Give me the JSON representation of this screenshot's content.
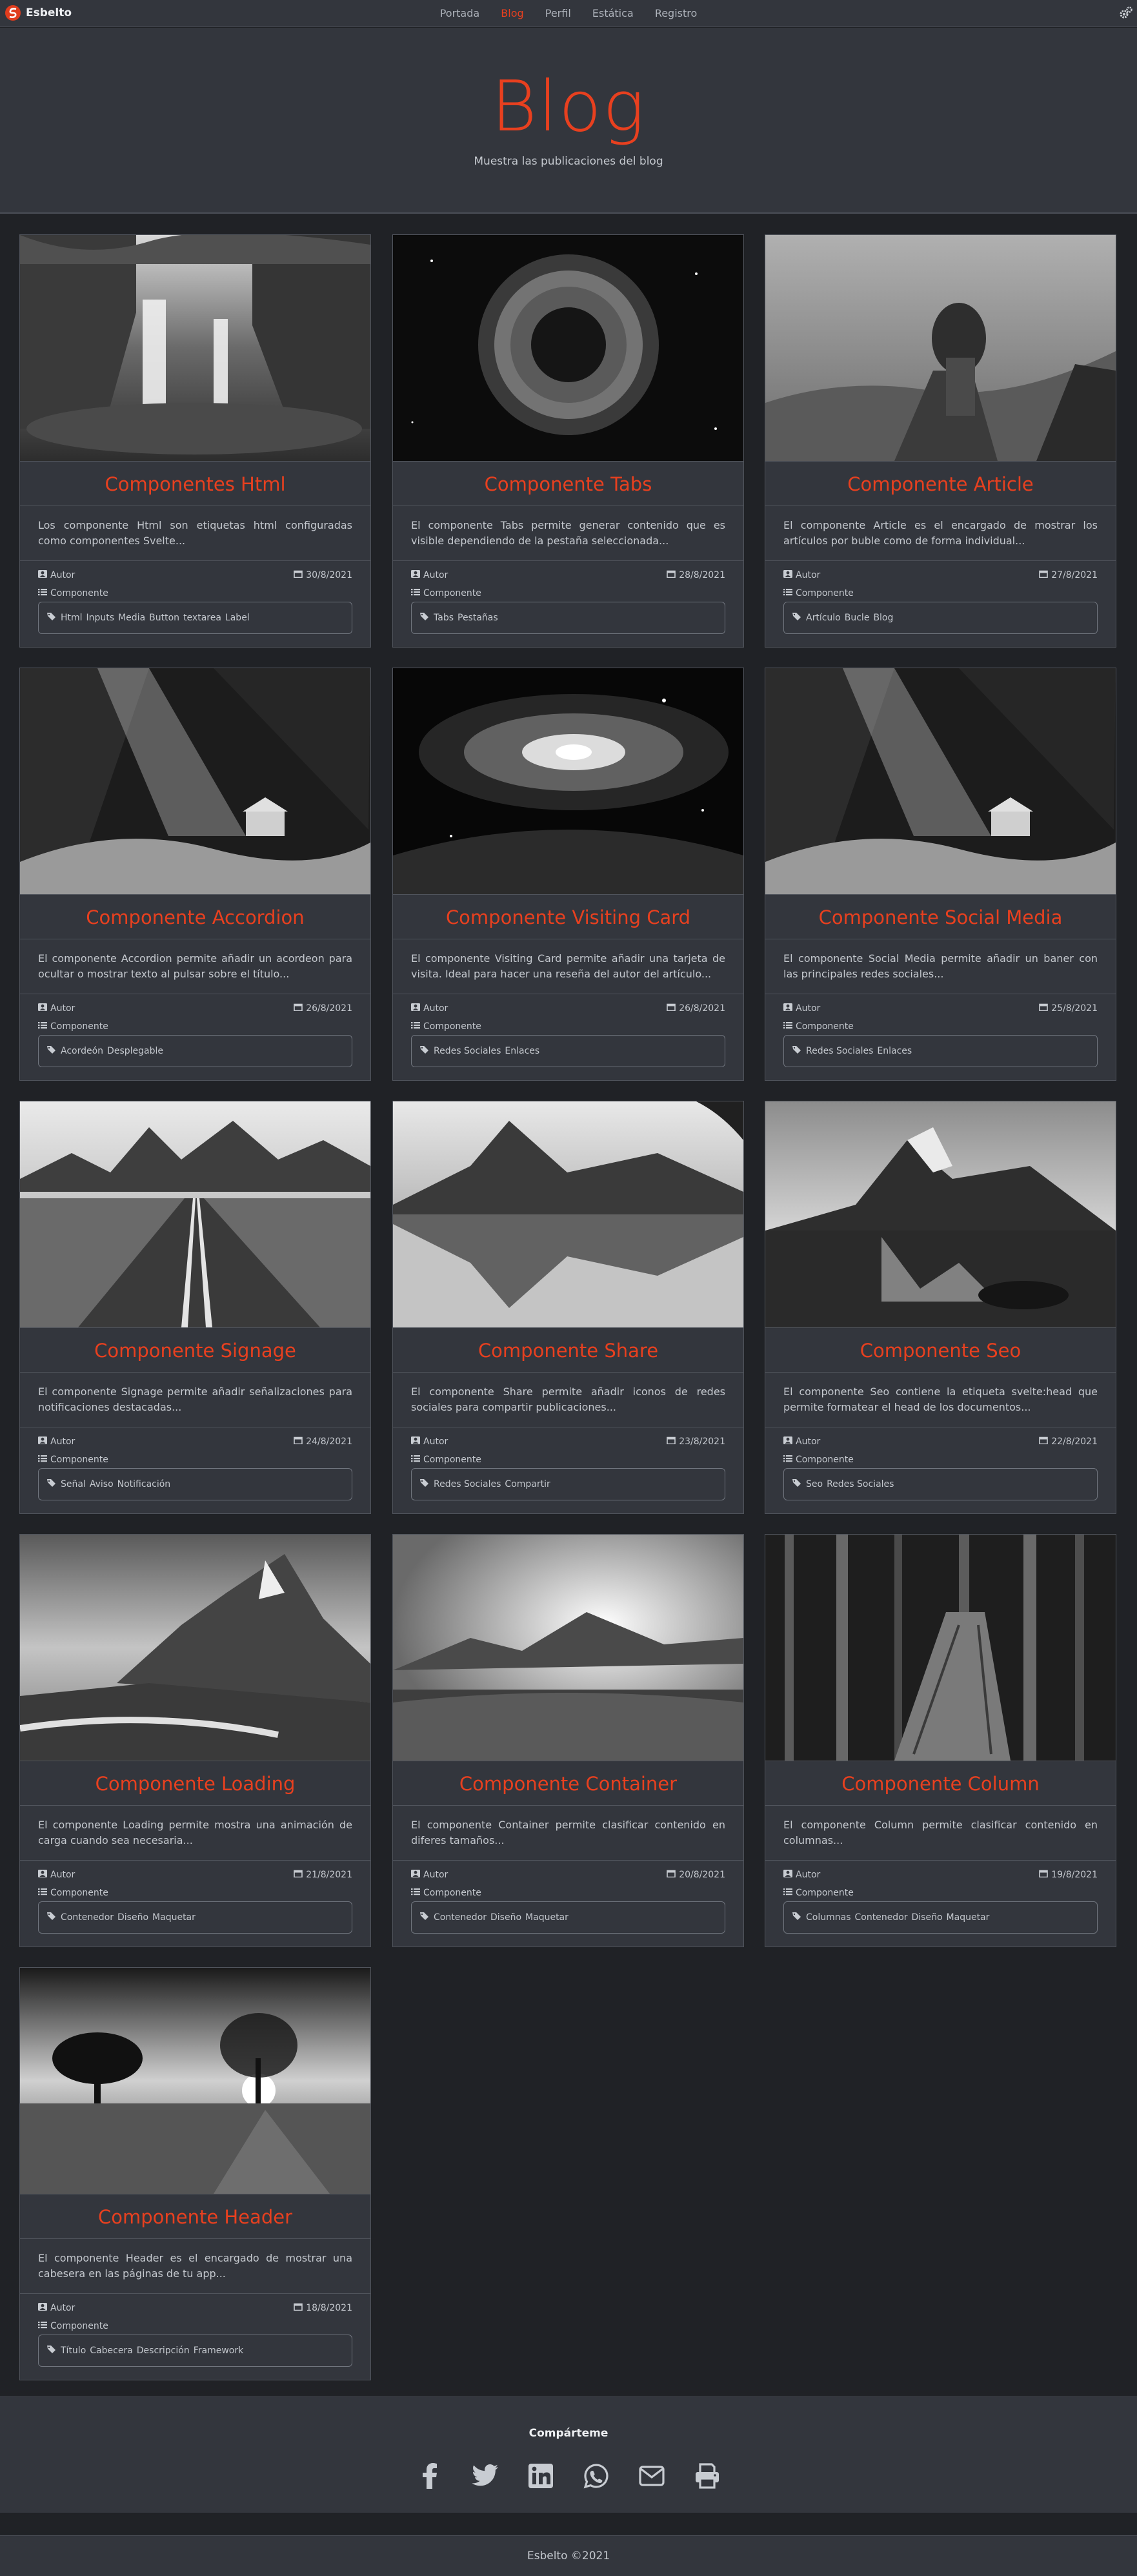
{
  "nav": {
    "brand": "Esbelto",
    "links": [
      "Portada",
      "Blog",
      "Perfil",
      "Estática",
      "Registro"
    ],
    "active": "Blog"
  },
  "hero": {
    "title": "Blog",
    "subtitle": "Muestra las publicaciones del blog"
  },
  "cards": [
    {
      "title": "Componentes Html",
      "desc": "Los componente Html son etiquetas html configuradas como componentes Svelte...",
      "author": "Autor",
      "date": "30/8/2021",
      "category": "Componente",
      "tags": [
        "Html",
        "Inputs",
        "Media",
        "Button",
        "textarea",
        "Label"
      ],
      "image": "waterfall"
    },
    {
      "title": "Componente Tabs",
      "desc": "El componente Tabs permite generar contenido que es visible dependiendo de la pestaña seleccionada...",
      "author": "Autor",
      "date": "28/8/2021",
      "category": "Componente",
      "tags": [
        "Tabs",
        "Pestañas"
      ],
      "image": "nebula"
    },
    {
      "title": "Componente Article",
      "desc": "El componente Article es el encargado de mostrar los artículos por buble como de forma individual...",
      "author": "Autor",
      "date": "27/8/2021",
      "category": "Componente",
      "tags": [
        "Artículo",
        "Bucle",
        "Blog"
      ],
      "image": "lion"
    },
    {
      "title": "Componente Accordion",
      "desc": "El componente Accordion permite añadir un acordeon para ocultar o mostrar texto al pulsar sobre el título...",
      "author": "Autor",
      "date": "26/8/2021",
      "category": "Componente",
      "tags": [
        "Acordeón",
        "Desplegable"
      ],
      "image": "cave"
    },
    {
      "title": "Componente Visiting Card",
      "desc": "El componente Visiting Card permite añadir una tarjeta de visita. Ideal para hacer una reseña del autor del artículo...",
      "author": "Autor",
      "date": "26/8/2021",
      "category": "Componente",
      "tags": [
        "Redes Sociales",
        "Enlaces"
      ],
      "image": "galaxy"
    },
    {
      "title": "Componente Social Media",
      "desc": "El componente Social Media permite añadir un baner con las principales redes sociales...",
      "author": "Autor",
      "date": "25/8/2021",
      "category": "Componente",
      "tags": [
        "Redes Sociales",
        "Enlaces"
      ],
      "image": "cave"
    },
    {
      "title": "Componente Signage",
      "desc": "El componente Signage permite añadir señalizaciones para notificaciones destacadas...",
      "author": "Autor",
      "date": "24/8/2021",
      "category": "Componente",
      "tags": [
        "Señal",
        "Aviso",
        "Notificación"
      ],
      "image": "road"
    },
    {
      "title": "Componente Share",
      "desc": "El componente Share permite añadir iconos de redes sociales para compartir publicaciones...",
      "author": "Autor",
      "date": "23/8/2021",
      "category": "Componente",
      "tags": [
        "Redes Sociales",
        "Compartir"
      ],
      "image": "lake"
    },
    {
      "title": "Componente Seo",
      "desc": "El componente Seo contiene la etiqueta svelte:head que permite formatear el head de los documentos...",
      "author": "Autor",
      "date": "22/8/2021",
      "category": "Componente",
      "tags": [
        "Seo",
        "Redes Sociales"
      ],
      "image": "mountainlake"
    },
    {
      "title": "Componente Loading",
      "desc": "El componente Loading permite mostra una animación de carga cuando sea necesaria...",
      "author": "Autor",
      "date": "21/8/2021",
      "category": "Componente",
      "tags": [
        "Contenedor",
        "Diseño",
        "Maquetar"
      ],
      "image": "peaks"
    },
    {
      "title": "Componente Container",
      "desc": "El componente Container permite clasificar contenido en diferes tamaños...",
      "author": "Autor",
      "date": "20/8/2021",
      "category": "Componente",
      "tags": [
        "Contenedor",
        "Diseño",
        "Maquetar"
      ],
      "image": "sunset"
    },
    {
      "title": "Componente Column",
      "desc": "El componente Column permite clasificar contenido en columnas...",
      "author": "Autor",
      "date": "19/8/2021",
      "category": "Componente",
      "tags": [
        "Columnas",
        "Contenedor",
        "Diseño",
        "Maquetar"
      ],
      "image": "forest"
    },
    {
      "title": "Componente Header",
      "desc": "El componente Header es el encargado de mostrar una cabesera en las páginas de tu app...",
      "author": "Autor",
      "date": "18/8/2021",
      "category": "Componente",
      "tags": [
        "Título",
        "Cabecera",
        "Descripción",
        "Framework"
      ],
      "image": "trees"
    }
  ],
  "share": {
    "title": "Compárteme",
    "icons": [
      "facebook-icon",
      "twitter-icon",
      "linkedin-icon",
      "whatsapp-icon",
      "email-icon",
      "print-icon"
    ]
  },
  "footer": {
    "copyright": "Esbelto ©2021"
  },
  "colors": {
    "accent": "#e8401f",
    "background": "#202226",
    "panel": "#33363d"
  }
}
